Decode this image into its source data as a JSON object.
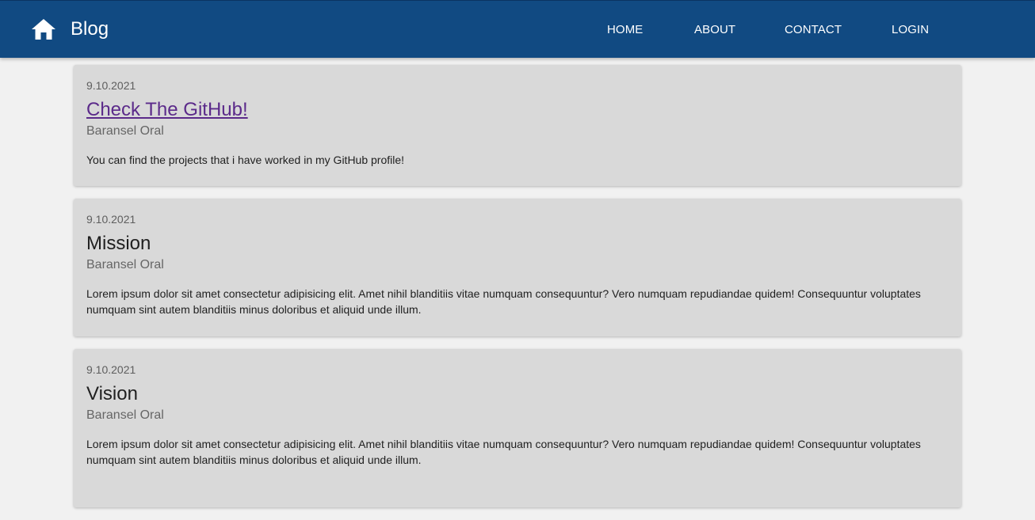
{
  "header": {
    "brand": "Blog",
    "home_icon": "home-icon",
    "background_color": "#114a82",
    "nav": [
      {
        "label": "HOME"
      },
      {
        "label": "ABOUT"
      },
      {
        "label": "CONTACT"
      },
      {
        "label": "LOGIN"
      }
    ]
  },
  "posts": [
    {
      "date": "9.10.2021",
      "title": "Check The GitHub!",
      "title_is_link": true,
      "author": "Baransel Oral",
      "body": "You can find the projects that i have worked in my GitHub profile!"
    },
    {
      "date": "9.10.2021",
      "title": "Mission",
      "title_is_link": false,
      "author": "Baransel Oral",
      "body": "Lorem ipsum dolor sit amet consectetur adipisicing elit. Amet nihil blanditiis vitae numquam consequuntur? Vero numquam repudiandae quidem! Consequuntur voluptates numquam sint autem blanditiis minus doloribus et aliquid unde illum."
    },
    {
      "date": "9.10.2021",
      "title": "Vision",
      "title_is_link": false,
      "author": "Baransel Oral",
      "body": "Lorem ipsum dolor sit amet consectetur adipisicing elit. Amet nihil blanditiis vitae numquam consequuntur? Vero numquam repudiandae quidem! Consequuntur voluptates numquam sint autem blanditiis minus doloribus et aliquid unde illum."
    }
  ]
}
